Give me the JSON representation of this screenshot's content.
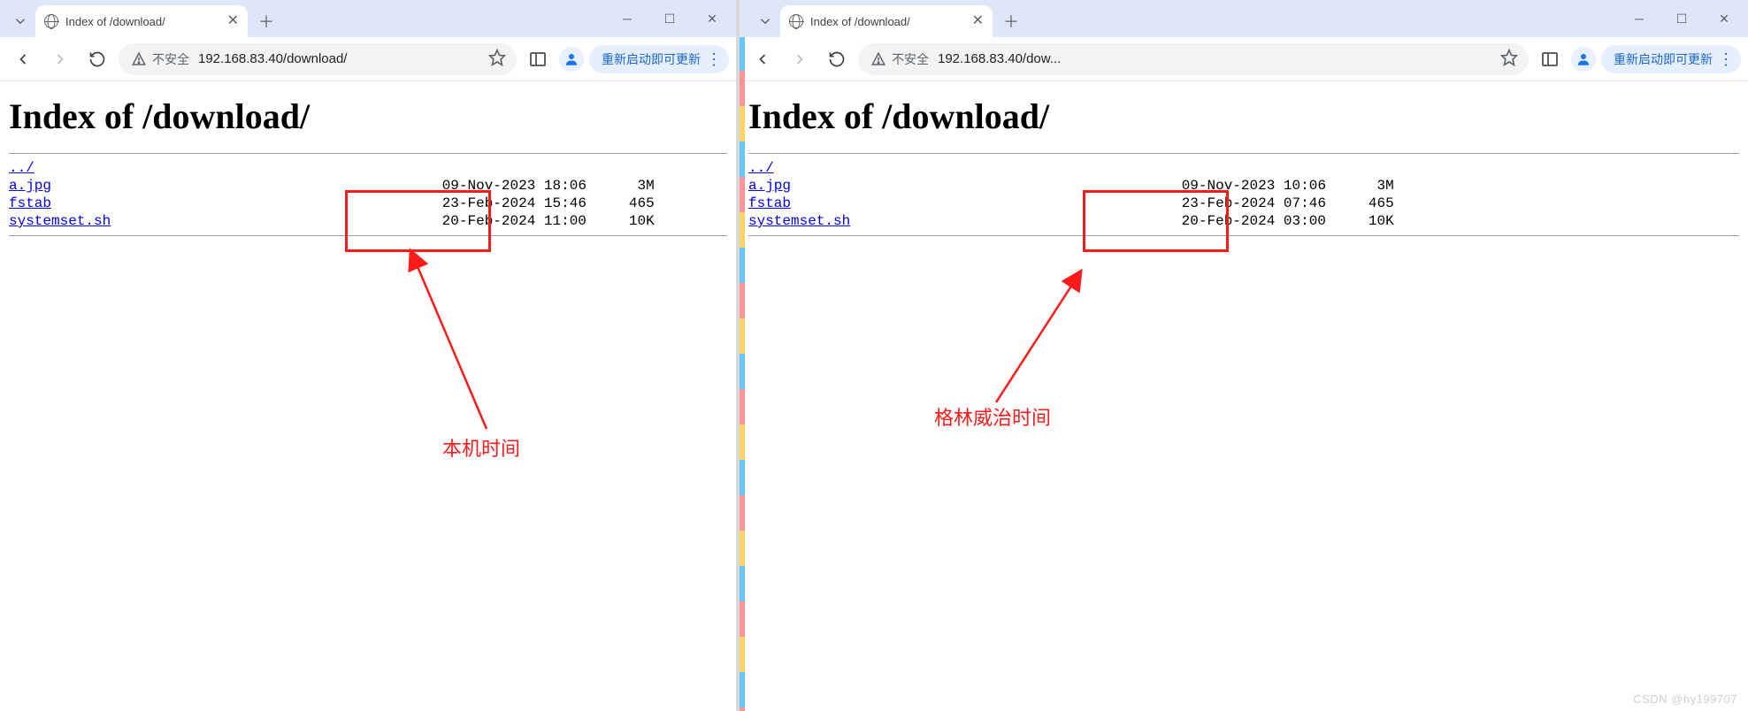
{
  "left": {
    "tab_title": "Index of /download/",
    "security_label": "不安全",
    "url_display": "192.168.83.40/download/",
    "update_label": "重新启动即可更新",
    "heading": "Index of /download/",
    "parent_link": "../",
    "files": [
      {
        "name": "a.jpg",
        "mtime": "09-Nov-2023 18:06",
        "size": "3M"
      },
      {
        "name": "fstab",
        "mtime": "23-Feb-2024 15:46",
        "size": "465"
      },
      {
        "name": "systemset.sh",
        "mtime": "20-Feb-2024 11:00",
        "size": "10K"
      }
    ],
    "annotation_label": "本机时间"
  },
  "right": {
    "tab_title": "Index of /download/",
    "security_label": "不安全",
    "url_display": "192.168.83.40/dow...",
    "update_label": "重新启动即可更新",
    "heading": "Index of /download/",
    "parent_link": "../",
    "files": [
      {
        "name": "a.jpg",
        "mtime": "09-Nov-2023 10:06",
        "size": "3M"
      },
      {
        "name": "fstab",
        "mtime": "23-Feb-2024 07:46",
        "size": "465"
      },
      {
        "name": "systemset.sh",
        "mtime": "20-Feb-2024 03:00",
        "size": "10K"
      }
    ],
    "annotation_label": "格林威治时间"
  },
  "watermark": "CSDN @hy199707"
}
